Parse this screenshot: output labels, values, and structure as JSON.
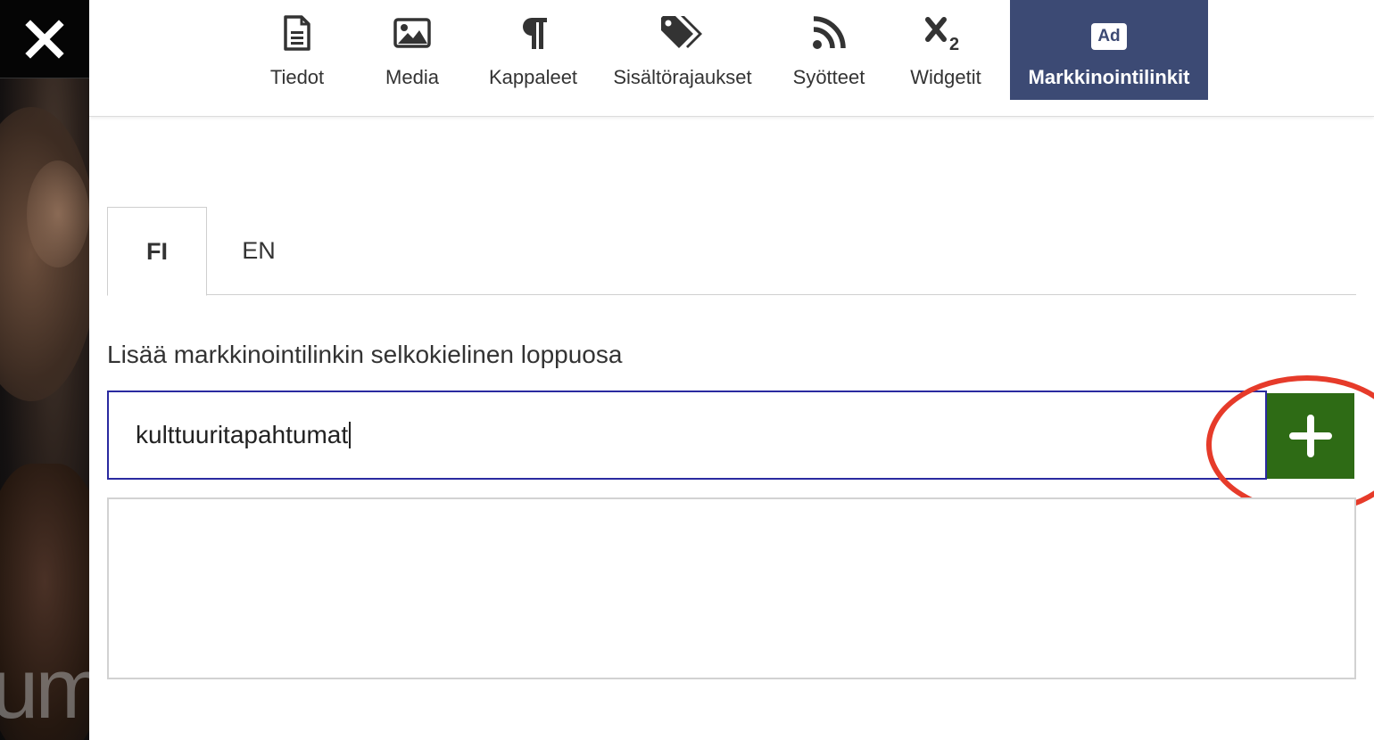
{
  "window": {
    "close_icon": "close-icon"
  },
  "background": {
    "partial_word": "um"
  },
  "toolbar": {
    "items": [
      {
        "label": "Tiedot",
        "icon": "document-icon"
      },
      {
        "label": "Media",
        "icon": "image-icon"
      },
      {
        "label": "Kappaleet",
        "icon": "paragraph-icon"
      },
      {
        "label": "Sisältörajaukset",
        "icon": "tags-icon"
      },
      {
        "label": "Syötteet",
        "icon": "rss-icon"
      },
      {
        "label": "Widgetit",
        "icon": "subscript-icon"
      },
      {
        "label": "Markkinointilinkit",
        "icon": "ad-icon",
        "badge": "Ad",
        "active": true
      }
    ]
  },
  "tabs": [
    {
      "label": "FI",
      "active": true
    },
    {
      "label": "EN",
      "active": false
    }
  ],
  "form": {
    "label": "Lisää markkinointilinkin selkokielinen loppuosa",
    "input_value": "kulttuuritapahtumat",
    "add_button_icon": "plus-icon"
  },
  "colors": {
    "active_tab_bg": "#3c4a74",
    "add_button_bg": "#2e6b15",
    "input_border": "#2a2aa0",
    "highlight_ring": "#e63b2a"
  }
}
